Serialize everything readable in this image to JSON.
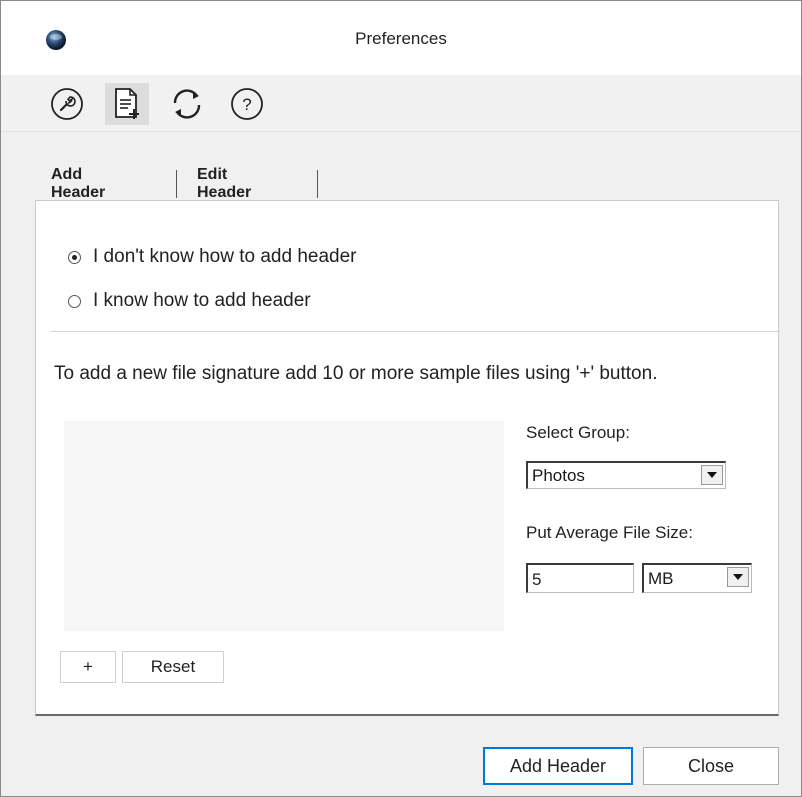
{
  "window": {
    "title": "Preferences"
  },
  "toolbar": {
    "buttons": [
      {
        "icon": "wrench-icon",
        "active": false
      },
      {
        "icon": "document-add-icon",
        "active": true
      },
      {
        "icon": "refresh-icon",
        "active": false
      },
      {
        "icon": "help-icon",
        "active": false
      }
    ]
  },
  "tabs": [
    {
      "label": "Add Header",
      "selected": true
    },
    {
      "label": "Edit Header",
      "selected": false
    }
  ],
  "mode": {
    "option_unknown": "I don't know how to add header",
    "option_known": "I know how to add header",
    "selected": "option_unknown"
  },
  "instruction": "To add a new file signature add 10 or more sample files using '+' button.",
  "group": {
    "label": "Select Group:",
    "value": "Photos"
  },
  "file_size": {
    "label": "Put  Average File Size:",
    "value": "5",
    "unit": "MB"
  },
  "sample_buttons": {
    "add": "+",
    "reset": "Reset"
  },
  "footer": {
    "add_header": "Add Header",
    "close": "Close"
  },
  "colors": {
    "default_button_border": "#0078d7",
    "content_background": "#f0f0f0"
  }
}
